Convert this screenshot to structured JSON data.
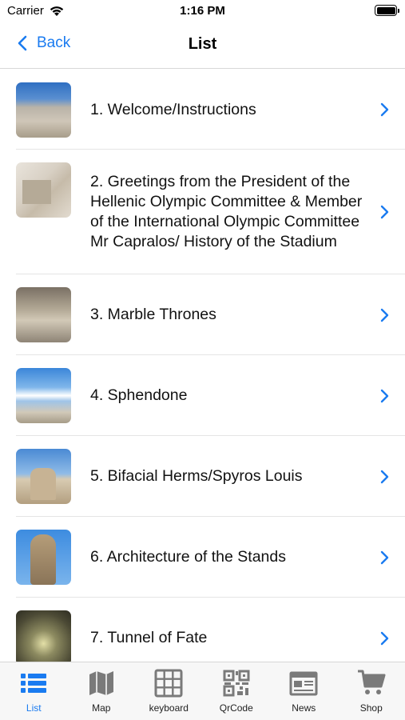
{
  "status": {
    "carrier": "Carrier",
    "time": "1:16 PM"
  },
  "nav": {
    "back_label": "Back",
    "title": "List"
  },
  "list": {
    "items": [
      {
        "label": "1. Welcome/Instructions",
        "thumb": "stadium-panorama"
      },
      {
        "label": "2. Greetings from the President of the Hellenic Olympic Committee & Member of the International Olympic Committee Mr Capralos/ History of the Stadium",
        "thumb": "marble-blocks"
      },
      {
        "label": "3. Marble Thrones",
        "thumb": "marble-thrones"
      },
      {
        "label": "4. Sphendone",
        "thumb": "sphendone"
      },
      {
        "label": "5. Bifacial Herms/Spyros Louis",
        "thumb": "bifacial-herms"
      },
      {
        "label": "6. Architecture of the Stands",
        "thumb": "statue"
      },
      {
        "label": "7. Tunnel of Fate",
        "thumb": "tunnel"
      }
    ]
  },
  "tabs": [
    {
      "label": "List",
      "icon": "list-icon",
      "active": true
    },
    {
      "label": "Map",
      "icon": "map-icon"
    },
    {
      "label": "keyboard",
      "icon": "keyboard-icon"
    },
    {
      "label": "QrCode",
      "icon": "qrcode-icon"
    },
    {
      "label": "News",
      "icon": "news-icon"
    },
    {
      "label": "Shop",
      "icon": "cart-icon"
    }
  ],
  "colors": {
    "accent": "#1a7bf0",
    "tab_icon": "#7a7a7a"
  }
}
